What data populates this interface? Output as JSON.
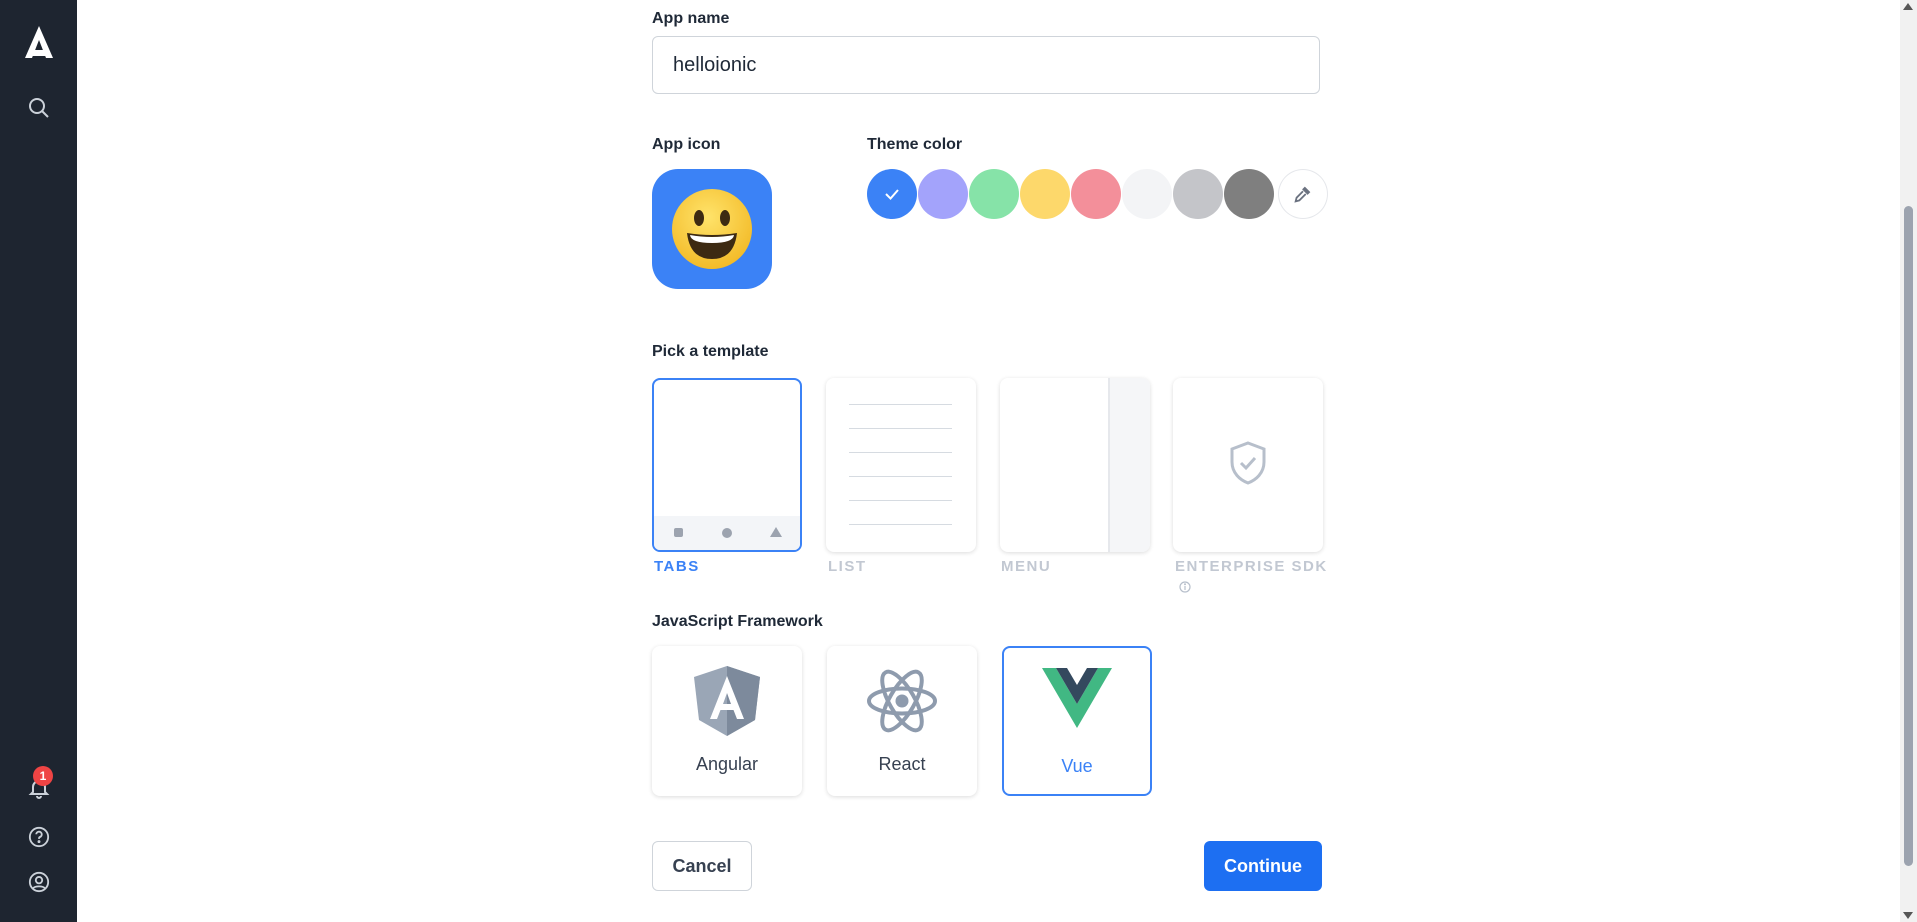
{
  "sidebar": {
    "logo_icon": "app-logo-a",
    "search_icon": "search-icon",
    "notifications": {
      "icon": "bell-icon",
      "badge_count": "1"
    },
    "help_icon": "help-circle-icon",
    "account_icon": "user-circle-icon"
  },
  "form": {
    "app_name": {
      "label": "App name",
      "value": "helloionic"
    },
    "app_icon": {
      "label": "App icon",
      "emoji": "😃"
    },
    "theme_color": {
      "label": "Theme color",
      "selected_index": 0,
      "swatches": [
        "#3b82f6",
        "#a3a3fb",
        "#86e3a8",
        "#fdd86b",
        "#f38f9a",
        "#f3f4f6",
        "#c4c5c9",
        "#7f7f7f"
      ],
      "picker_icon": "eyedropper-icon"
    },
    "template": {
      "label": "Pick a template",
      "options": [
        {
          "label": "TABS",
          "selected": true
        },
        {
          "label": "LIST",
          "selected": false
        },
        {
          "label": "MENU",
          "selected": false
        },
        {
          "label": "ENTERPRISE SDK",
          "selected": false,
          "info_icon": "info-icon"
        }
      ]
    },
    "framework": {
      "label": "JavaScript Framework",
      "options": [
        {
          "label": "Angular",
          "selected": false
        },
        {
          "label": "React",
          "selected": false
        },
        {
          "label": "Vue",
          "selected": true
        }
      ]
    },
    "actions": {
      "cancel": "Cancel",
      "continue": "Continue"
    }
  },
  "colors": {
    "accent": "#1d6ff2",
    "sidebar_bg": "#1e2530"
  }
}
